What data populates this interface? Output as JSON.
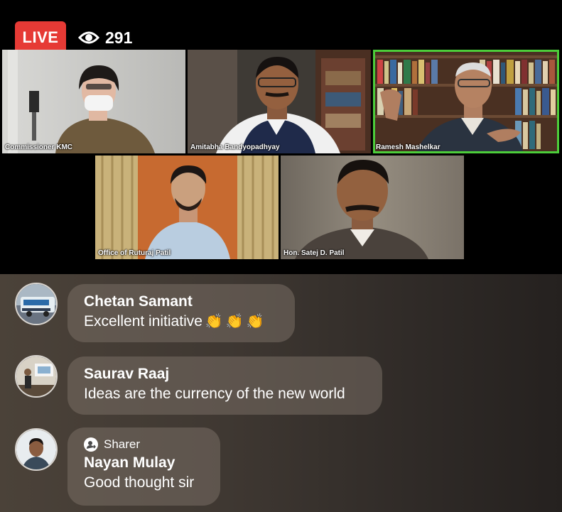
{
  "live": {
    "label": "LIVE",
    "viewers": "291",
    "eye_icon": "eye-icon",
    "badge_color": "#e63a35"
  },
  "participants": [
    {
      "name": "Commissioner KMC"
    },
    {
      "name": "Amitabha Bandyopadhyay"
    },
    {
      "name": "Ramesh Mashelkar",
      "active_speaker": true,
      "highlight_color": "#4ccd3a"
    },
    {
      "name": "Office of Ruturaj Patil"
    },
    {
      "name": "Hon. Satej D. Patil"
    }
  ],
  "comments": [
    {
      "author": "Chetan Samant",
      "text": "Excellent initiative",
      "emoji": [
        "👏",
        "👏",
        "👏"
      ]
    },
    {
      "author": "Saurav Raaj",
      "text": "Ideas are the currency of the new world"
    },
    {
      "author": "Nayan Mulay",
      "badge": "Sharer",
      "badge_icon": "sharer-icon",
      "text": "Good thought sir"
    }
  ]
}
